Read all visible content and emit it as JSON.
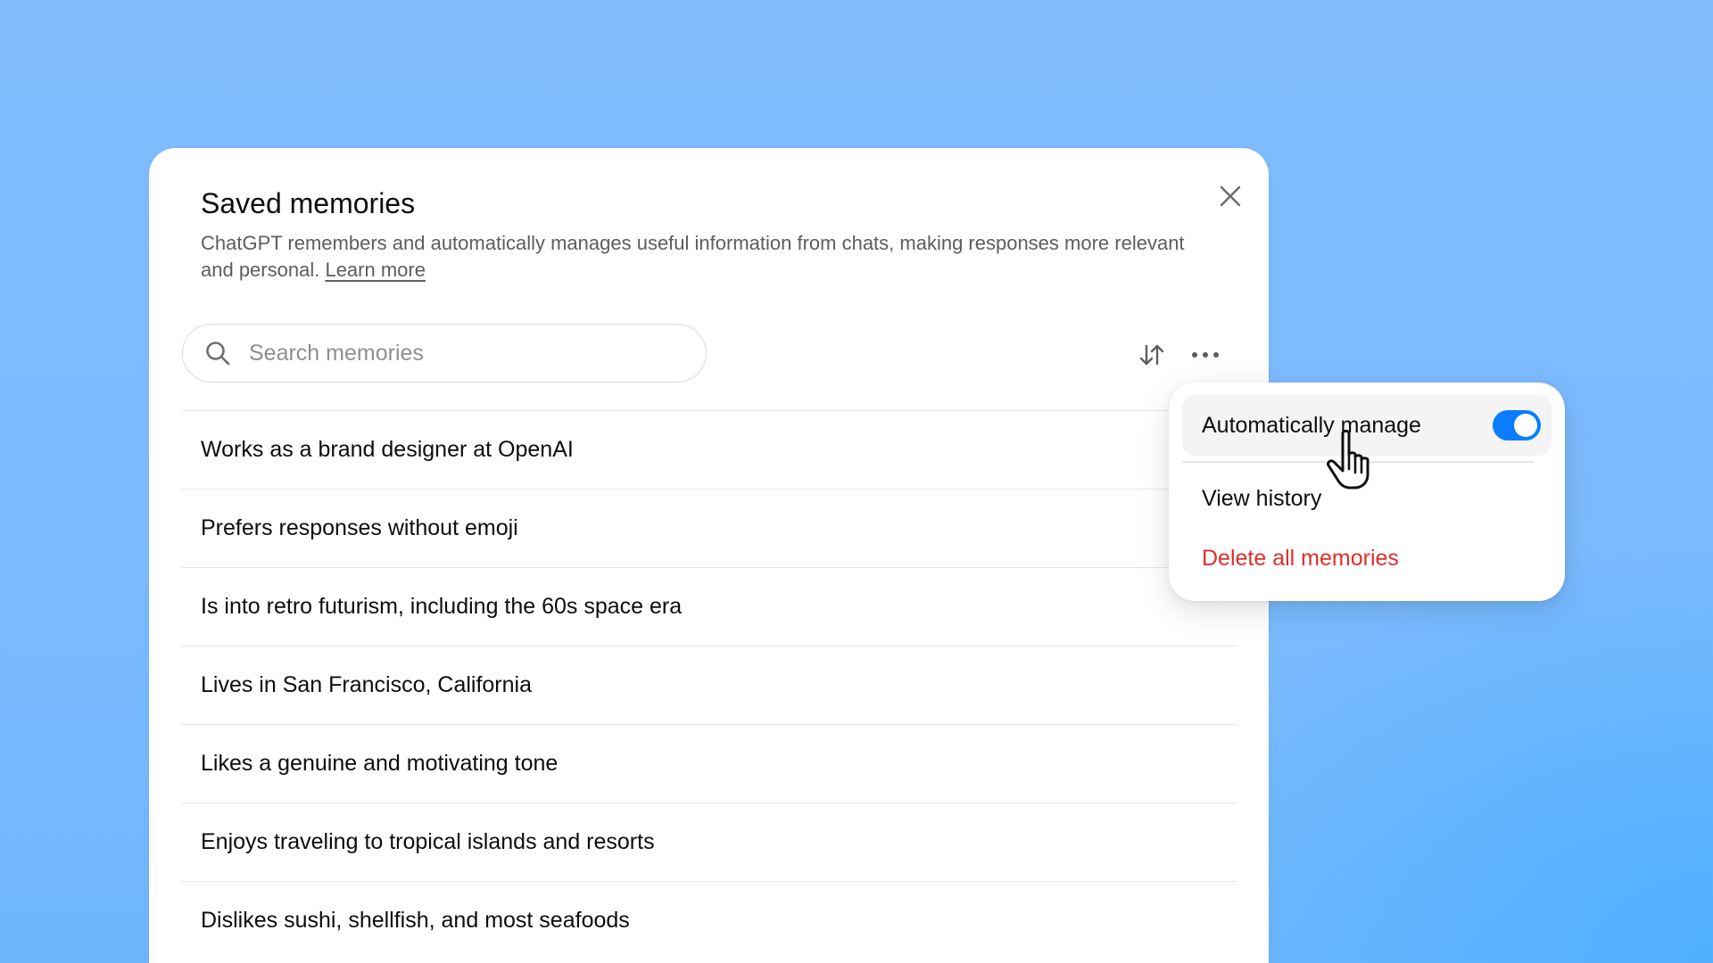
{
  "modal": {
    "title": "Saved memories",
    "description": "ChatGPT remembers and automatically manages useful information from chats, making responses more relevant and personal.",
    "learn_more": "Learn more",
    "close_icon": "close-icon"
  },
  "search": {
    "placeholder": "Search memories",
    "value": "",
    "icon": "search-icon"
  },
  "toolbar": {
    "sort_icon": "sort-arrows-icon",
    "more_icon": "more-horizontal-icon"
  },
  "memories": [
    "Works as a brand designer at OpenAI",
    "Prefers responses without emoji",
    "Is into retro futurism, including the 60s space era",
    "Lives in San Francisco, California",
    "Likes a genuine and motivating tone",
    "Enjoys traveling to tropical islands and resorts",
    "Dislikes sushi, shellfish, and most seafoods"
  ],
  "menu": {
    "auto_manage_label": "Automatically manage",
    "auto_manage_enabled": true,
    "view_history_label": "View history",
    "delete_all_label": "Delete all memories"
  },
  "colors": {
    "accent": "#0a7cff",
    "danger": "#e02e2a",
    "background": "#7cbbff"
  }
}
